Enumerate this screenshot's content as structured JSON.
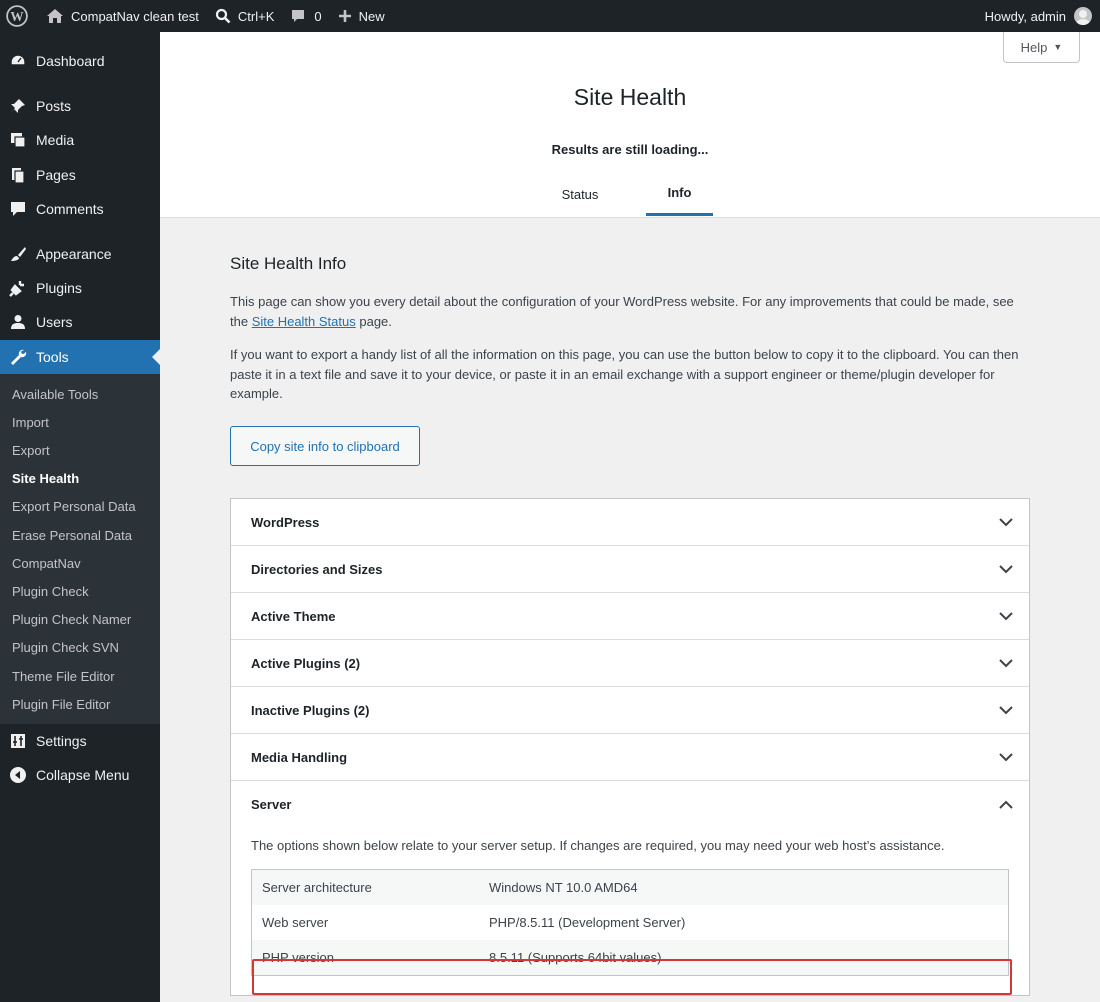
{
  "adminbar": {
    "site_name": "CompatNav clean test",
    "search_label": "Ctrl+K",
    "comments_count": "0",
    "new_label": "New",
    "howdy": "Howdy, admin"
  },
  "sidebar": {
    "items": [
      {
        "label": "Dashboard",
        "icon": "dashboard-icon"
      },
      {
        "label": "Posts",
        "icon": "pin-icon"
      },
      {
        "label": "Media",
        "icon": "media-icon"
      },
      {
        "label": "Pages",
        "icon": "pages-icon"
      },
      {
        "label": "Comments",
        "icon": "comment-icon"
      },
      {
        "label": "Appearance",
        "icon": "paintbrush-icon"
      },
      {
        "label": "Plugins",
        "icon": "plugin-icon"
      },
      {
        "label": "Users",
        "icon": "users-icon"
      },
      {
        "label": "Tools",
        "icon": "wrench-icon"
      },
      {
        "label": "Settings",
        "icon": "settings-icon"
      },
      {
        "label": "Collapse Menu",
        "icon": "collapse-icon"
      }
    ],
    "submenu": [
      "Available Tools",
      "Import",
      "Export",
      "Site Health",
      "Export Personal Data",
      "Erase Personal Data",
      "CompatNav",
      "Plugin Check",
      "Plugin Check Namer",
      "Plugin Check SVN",
      "Theme File Editor",
      "Plugin File Editor"
    ]
  },
  "header": {
    "help_label": "Help",
    "title": "Site Health",
    "loading": "Results are still loading...",
    "tabs": [
      "Status",
      "Info"
    ]
  },
  "main": {
    "section_title": "Site Health Info",
    "para1_before": "This page can show you every detail about the configuration of your WordPress website. For any improvements that could be made, see the ",
    "para1_link": "Site Health Status",
    "para1_after": " page.",
    "para2": "If you want to export a handy list of all the information on this page, you can use the button below to copy it to the clipboard. You can then paste it in a text file and save it to your device, or paste it in an email exchange with a support engineer or theme/plugin developer for example.",
    "copy_button": "Copy site info to clipboard",
    "sections": [
      "WordPress",
      "Directories and Sizes",
      "Active Theme",
      "Active Plugins (2)",
      "Inactive Plugins (2)",
      "Media Handling",
      "Server"
    ],
    "server_desc": "The options shown below relate to your server setup. If changes are required, you may need your web host’s assistance.",
    "server_rows": [
      {
        "key": "Server architecture",
        "value": "Windows NT 10.0 AMD64"
      },
      {
        "key": "Web server",
        "value": "PHP/8.5.11 (Development Server)"
      },
      {
        "key": "PHP version",
        "value": "8.5.11 (Supports 64bit values)"
      }
    ]
  },
  "colors": {
    "accent": "#2271b1",
    "sidebar_bg": "#1d2327",
    "highlight": "#d63638"
  }
}
